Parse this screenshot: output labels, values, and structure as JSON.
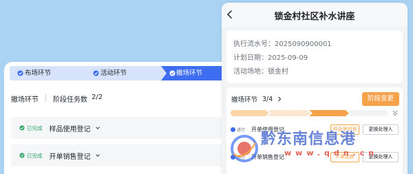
{
  "desktop": {
    "steps": [
      {
        "label": "布场环节",
        "state": "done"
      },
      {
        "label": "活动环节",
        "state": "done"
      },
      {
        "label": "撤场环节",
        "state": "active"
      }
    ],
    "stage_name": "撤场环节",
    "stage_task_label": "阶段任务数",
    "stage_task_count": "2/2",
    "tasks": [
      {
        "status": "已完成",
        "name": "样品使用登记"
      },
      {
        "status": "已完成",
        "name": "开单销售登记"
      }
    ]
  },
  "mobile": {
    "title": "锁金村社区补水讲座",
    "info": {
      "serial": "执行流水号：2025090900001",
      "plan_date": "计划日期：2025-09-09",
      "venue": "活动场地：锁金村"
    },
    "stage_label": "撤场环节",
    "stage_progress": "3/4",
    "change_button": "阶段变更",
    "progress": {
      "current": 3,
      "total": 4
    },
    "tasks": [
      {
        "status": "进行",
        "name": "开单使用登记",
        "tag": "样品使用登",
        "handler": "更换处理人"
      },
      {
        "status": "进行",
        "name": "开单销售登记",
        "tag": "开单销售",
        "handler": "更换处理人"
      }
    ]
  },
  "watermark": {
    "text": "黔东南信息港",
    "url": "www.qdn.cn"
  },
  "colors": {
    "background": "#a9d2f3",
    "active_step": "#3e6df2",
    "done_step": "#d6e3fb",
    "accent_orange": "#f6a24a",
    "done_green": "#2fa56a"
  }
}
